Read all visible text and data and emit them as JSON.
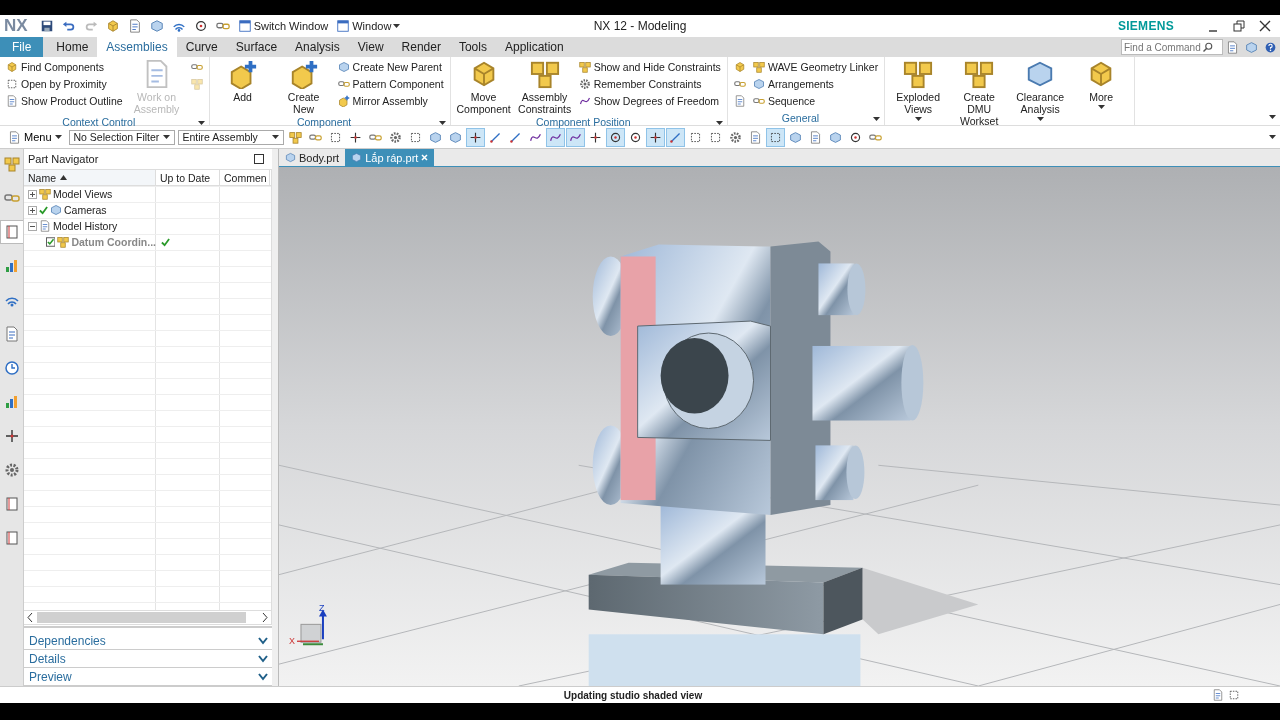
{
  "title_bar": {
    "logo": "NX",
    "switch_window": "Switch Window",
    "window_menu": "Window",
    "title": "NX 12 - Modeling",
    "brand": "SIEMENS"
  },
  "ribbon_tabs": [
    {
      "label": "File",
      "kind": "file",
      "selected": false
    },
    {
      "label": "Home",
      "kind": "tab",
      "selected": false
    },
    {
      "label": "Assemblies",
      "kind": "tab",
      "selected": true
    },
    {
      "label": "Curve",
      "kind": "tab",
      "selected": false
    },
    {
      "label": "Surface",
      "kind": "tab",
      "selected": false
    },
    {
      "label": "Analysis",
      "kind": "tab",
      "selected": false
    },
    {
      "label": "View",
      "kind": "tab",
      "selected": false
    },
    {
      "label": "Render",
      "kind": "tab",
      "selected": false
    },
    {
      "label": "Tools",
      "kind": "tab",
      "selected": false
    },
    {
      "label": "Application",
      "kind": "tab",
      "selected": false
    }
  ],
  "command_search": {
    "placeholder": "Find a Command"
  },
  "ribbon_groups": [
    {
      "caption": "Context Control",
      "items": [
        {
          "kind": "small",
          "label": "Find Components",
          "disabled": false
        },
        {
          "kind": "small",
          "label": "Open by Proximity",
          "disabled": false
        },
        {
          "kind": "small",
          "label": "Show Product Outline",
          "disabled": false
        },
        {
          "kind": "large",
          "label": "Work on Assembly",
          "disabled": true,
          "dropdown": false
        },
        {
          "kind": "icon",
          "disabled": false
        },
        {
          "kind": "icon",
          "disabled": true
        }
      ]
    },
    {
      "caption": "Component",
      "items": [
        {
          "kind": "large",
          "label": "Add",
          "disabled": false,
          "dropdown": false
        },
        {
          "kind": "large",
          "label": "Create New",
          "disabled": false,
          "dropdown": false
        },
        {
          "kind": "small",
          "label": "Create New Parent",
          "disabled": false
        },
        {
          "kind": "small",
          "label": "Pattern Component",
          "disabled": false
        },
        {
          "kind": "small",
          "label": "Mirror Assembly",
          "disabled": false
        }
      ]
    },
    {
      "caption": "Component Position",
      "items": [
        {
          "kind": "large",
          "label": "Move Component",
          "disabled": false,
          "dropdown": false
        },
        {
          "kind": "large",
          "label": "Assembly Constraints",
          "disabled": false,
          "dropdown": false
        },
        {
          "kind": "small",
          "label": "Show and Hide Constraints",
          "disabled": false
        },
        {
          "kind": "small",
          "label": "Remember Constraints",
          "disabled": false
        },
        {
          "kind": "small",
          "label": "Show Degrees of Freedom",
          "disabled": false
        }
      ]
    },
    {
      "caption": "General",
      "items": [
        {
          "kind": "icon",
          "disabled": false
        },
        {
          "kind": "icon",
          "disabled": false
        },
        {
          "kind": "icon",
          "disabled": false
        },
        {
          "kind": "small",
          "label": "WAVE Geometry Linker",
          "disabled": false
        },
        {
          "kind": "small",
          "label": "Arrangements",
          "disabled": false
        },
        {
          "kind": "small",
          "label": "Sequence",
          "disabled": false
        }
      ]
    },
    {
      "items": [
        {
          "kind": "large",
          "label": "Exploded Views",
          "disabled": false,
          "dropdown": true
        },
        {
          "kind": "large",
          "label": "Create DMU Workset",
          "disabled": false,
          "dropdown": false
        },
        {
          "kind": "large",
          "label": "Clearance Analysis",
          "disabled": false,
          "dropdown": true
        },
        {
          "kind": "large",
          "label": "More",
          "disabled": false,
          "dropdown": true
        }
      ]
    }
  ],
  "toolbar": {
    "menu": "Menu",
    "selection_filter": "No Selection Filter",
    "scope": "Entire Assembly",
    "tools": [
      {
        "on": false
      },
      {
        "on": false
      },
      {
        "on": false
      },
      {
        "on": false
      },
      {
        "on": false
      },
      {
        "on": false
      },
      {
        "on": false
      },
      {
        "on": false
      },
      {
        "on": false
      },
      {
        "on": true
      },
      {
        "on": false
      },
      {
        "on": false
      },
      {
        "on": false
      },
      {
        "on": true
      },
      {
        "on": true
      },
      {
        "on": false
      },
      {
        "on": true
      },
      {
        "on": false
      },
      {
        "on": true
      },
      {
        "on": true
      },
      {
        "on": false
      },
      {
        "on": false
      },
      {
        "on": false
      },
      {
        "on": false
      },
      {
        "on": true
      },
      {
        "on": false
      },
      {
        "on": false
      },
      {
        "on": false
      },
      {
        "on": false
      },
      {
        "on": false
      }
    ]
  },
  "resource_bar": [
    {
      "selected": false
    },
    {
      "selected": false
    },
    {
      "selected": true
    },
    {
      "selected": false
    },
    {
      "selected": false
    },
    {
      "selected": false
    },
    {
      "selected": false
    },
    {
      "selected": false
    },
    {
      "selected": false
    },
    {
      "selected": false
    },
    {
      "selected": false
    },
    {
      "selected": false
    }
  ],
  "part_navigator": {
    "title": "Part Navigator",
    "columns": [
      {
        "label": "Name",
        "sorted": true
      },
      {
        "label": "Up to Date",
        "sorted": false
      },
      {
        "label": "Commen",
        "sorted": false
      }
    ],
    "tree": [
      {
        "label": "Model Views",
        "expanded": false,
        "checked": false,
        "up_to_date": false,
        "dimmed": false
      },
      {
        "label": "Cameras",
        "expanded": false,
        "checked": true,
        "up_to_date": false,
        "dimmed": false
      },
      {
        "label": "Model History",
        "expanded": true,
        "checked": false,
        "up_to_date": false,
        "dimmed": false,
        "children": [
          {
            "label": "Datum Coordin...",
            "checked": true,
            "up_to_date": true,
            "dimmed": true
          }
        ]
      }
    ],
    "sections": [
      {
        "label": "Dependencies",
        "expanded": false
      },
      {
        "label": "Details",
        "expanded": false
      },
      {
        "label": "Preview",
        "expanded": false
      }
    ]
  },
  "document_tabs": [
    {
      "label": "Body.prt",
      "selected": false
    },
    {
      "label": "Lắp ráp.prt",
      "selected": true
    }
  ],
  "viewport": {
    "triad": {
      "z": "Z",
      "x": "X"
    }
  },
  "status_bar": {
    "message": "Updating studio shaded view"
  }
}
